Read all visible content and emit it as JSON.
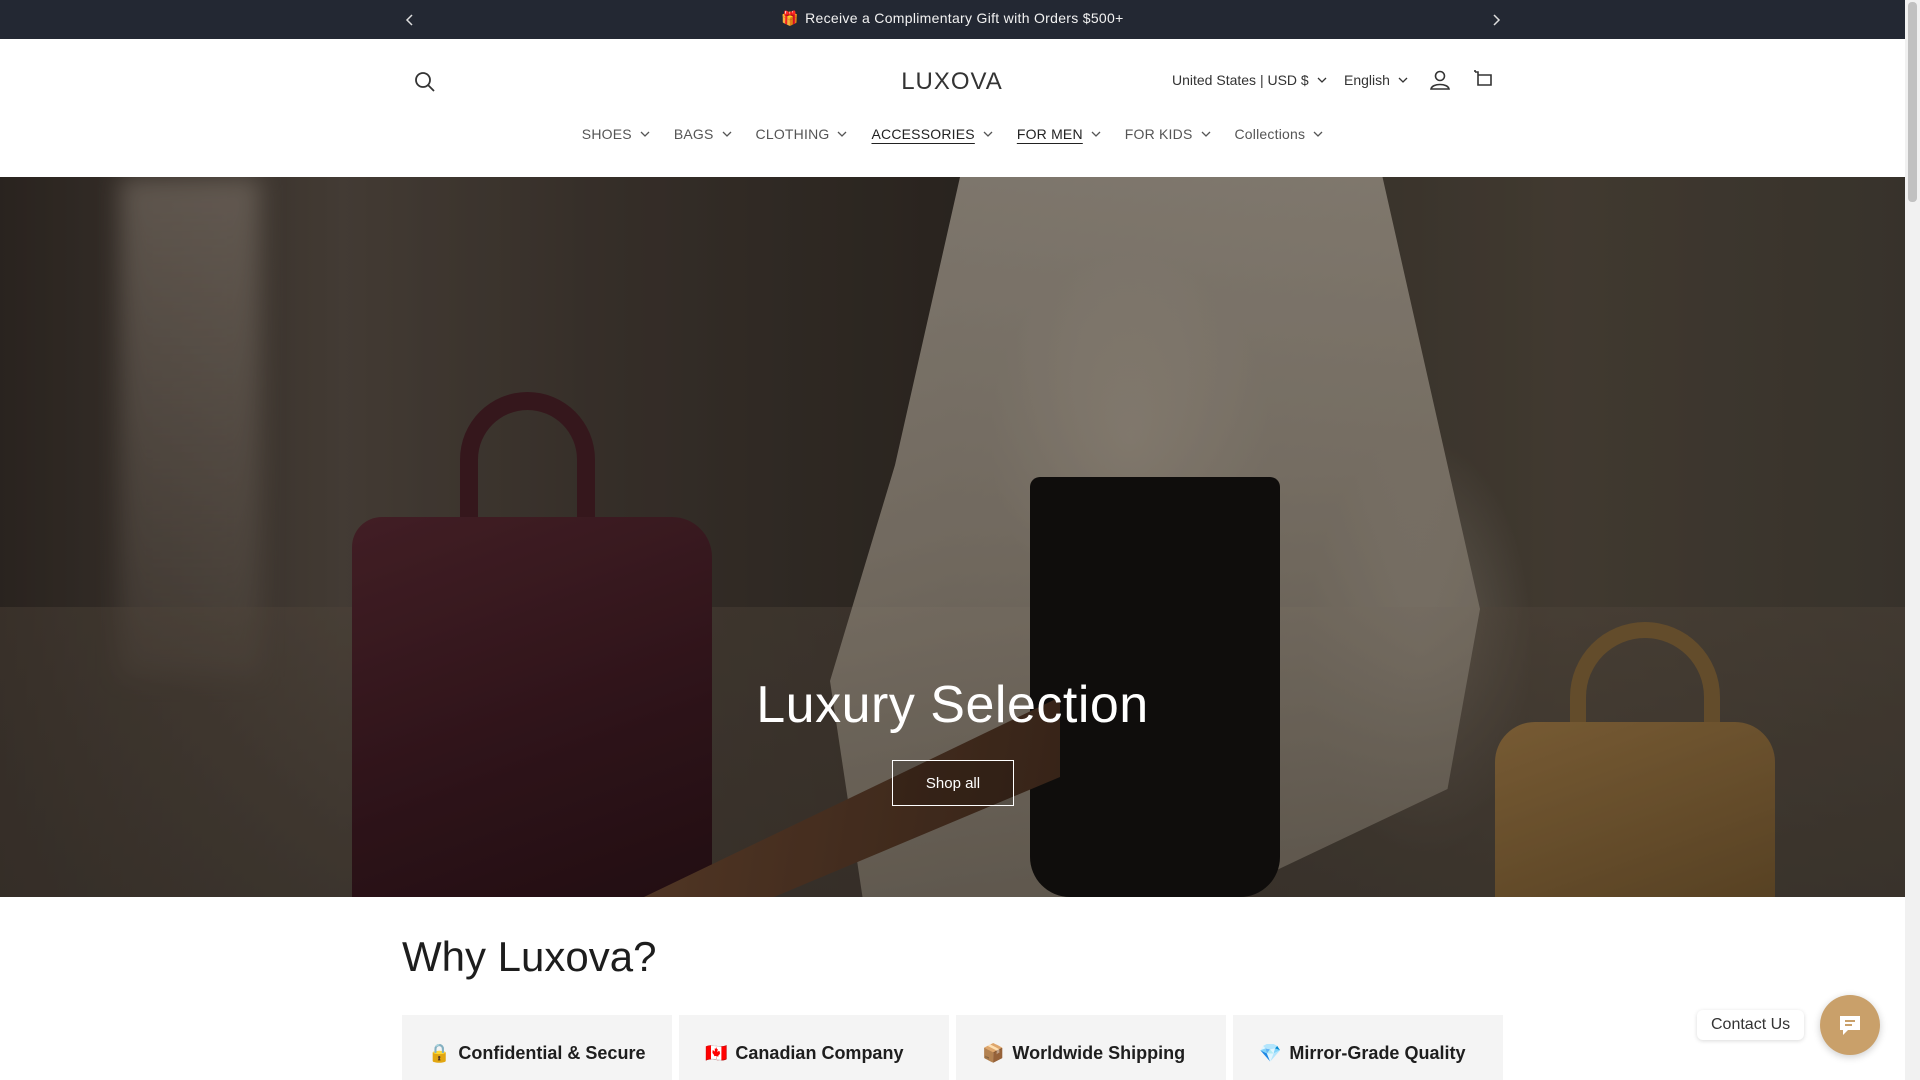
{
  "announcement": {
    "gift_icon": "gift-icon",
    "gift_glyph": "🎁",
    "text": "Receive a Complimentary Gift with Orders $500+"
  },
  "header": {
    "logo": "LUXOVA",
    "country": "United States | USD $",
    "language": "English"
  },
  "nav": {
    "items": [
      {
        "label": "SHOES"
      },
      {
        "label": "BAGS"
      },
      {
        "label": "CLOTHING"
      },
      {
        "label": "ACCESSORIES"
      },
      {
        "label": "FOR MEN"
      },
      {
        "label": "FOR KIDS"
      },
      {
        "label": "Collections"
      }
    ]
  },
  "hero": {
    "title": "Luxury Selection",
    "button": "Shop all"
  },
  "why": {
    "title": "Why Luxova?",
    "cards": [
      {
        "emoji": "🔒",
        "label": "Confidential & Secure"
      },
      {
        "emoji": "🇨🇦",
        "label": "Canadian Company"
      },
      {
        "emoji": "📦",
        "label": "Worldwide Shipping"
      },
      {
        "emoji": "💎",
        "label": "Mirror-Grade Quality"
      }
    ]
  },
  "contact": {
    "label": "Contact Us"
  },
  "colors": {
    "announcement_bg": "#232833",
    "accent": "#c9a06a",
    "card_bg": "#f4f4f4"
  }
}
